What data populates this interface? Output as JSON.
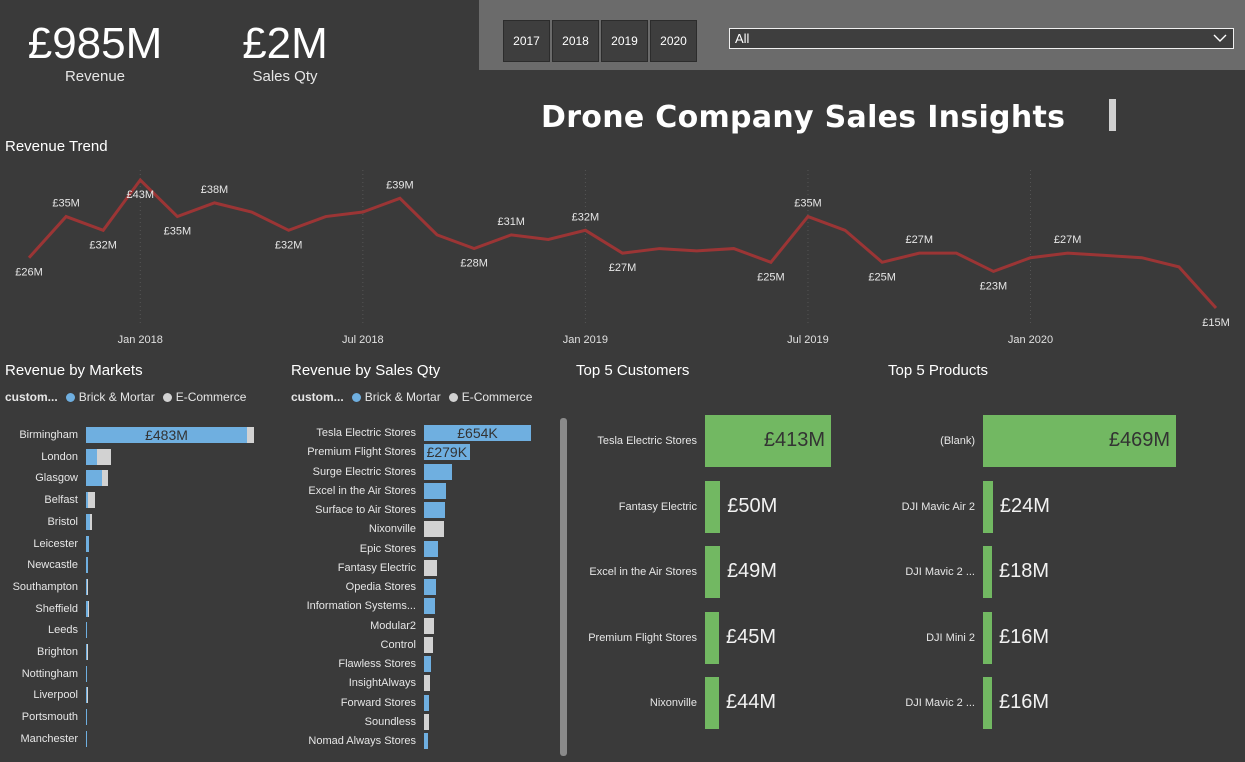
{
  "kpis": {
    "revenue": {
      "value": "£985M",
      "label": "Revenue"
    },
    "sales_qty": {
      "value": "£2M",
      "label": "Sales Qty"
    }
  },
  "year_slicer": {
    "buttons": [
      "2017",
      "2018",
      "2019",
      "2020"
    ]
  },
  "filter_dropdown": {
    "selected": "All",
    "icon": "chevron-down-icon"
  },
  "title": "Drone Company Sales Insights",
  "revenue_trend": {
    "title": "Revenue Trend",
    "x_ticks": [
      "Jan 2018",
      "Jul 2018",
      "Jan 2019",
      "Jul 2019",
      "Jan 2020"
    ],
    "line_color": "#9b3535"
  },
  "chart_data": [
    {
      "type": "line",
      "title": "Revenue Trend",
      "x": [
        "2017-10",
        "2017-11",
        "2017-12",
        "2018-01",
        "2018-02",
        "2018-03",
        "2018-04",
        "2018-05",
        "2018-06",
        "2018-07",
        "2018-08",
        "2018-09",
        "2018-10",
        "2018-11",
        "2018-12",
        "2019-01",
        "2019-02",
        "2019-03",
        "2019-04",
        "2019-05",
        "2019-06",
        "2019-07",
        "2019-08",
        "2019-09",
        "2019-10",
        "2019-11",
        "2019-12",
        "2020-01",
        "2020-02",
        "2020-03",
        "2020-04",
        "2020-05",
        "2020-06"
      ],
      "values": [
        26,
        35,
        32,
        43,
        35,
        38,
        36,
        32,
        35,
        36,
        39,
        31,
        28,
        31,
        30,
        32,
        27,
        28,
        27.5,
        28,
        25,
        35,
        32,
        25,
        27,
        27,
        23,
        26,
        27,
        26.5,
        26,
        24,
        15
      ],
      "data_labels": [
        {
          "i": 0,
          "text": "£26M",
          "pos": "below"
        },
        {
          "i": 1,
          "text": "£35M",
          "pos": "above"
        },
        {
          "i": 2,
          "text": "£32M",
          "pos": "below"
        },
        {
          "i": 3,
          "text": "£43M",
          "pos": "below"
        },
        {
          "i": 4,
          "text": "£35M",
          "pos": "below"
        },
        {
          "i": 5,
          "text": "£38M",
          "pos": "above"
        },
        {
          "i": 7,
          "text": "£32M",
          "pos": "below"
        },
        {
          "i": 10,
          "text": "£39M",
          "pos": "above"
        },
        {
          "i": 12,
          "text": "£28M",
          "pos": "below"
        },
        {
          "i": 13,
          "text": "£31M",
          "pos": "above"
        },
        {
          "i": 15,
          "text": "£32M",
          "pos": "above"
        },
        {
          "i": 16,
          "text": "£27M",
          "pos": "below"
        },
        {
          "i": 20,
          "text": "£25M",
          "pos": "below"
        },
        {
          "i": 21,
          "text": "£35M",
          "pos": "above"
        },
        {
          "i": 23,
          "text": "£25M",
          "pos": "below"
        },
        {
          "i": 24,
          "text": "£27M",
          "pos": "above"
        },
        {
          "i": 26,
          "text": "£23M",
          "pos": "below"
        },
        {
          "i": 28,
          "text": "£27M",
          "pos": "above"
        },
        {
          "i": 32,
          "text": "£15M",
          "pos": "below"
        }
      ],
      "xtick_labels": [
        "Jan 2018",
        "Jul 2018",
        "Jan 2019",
        "Jul 2019",
        "Jan 2020"
      ],
      "grid": false
    },
    {
      "type": "bar",
      "title": "Revenue by Markets",
      "legend": [
        "Brick & Mortar",
        "E-Commerce"
      ],
      "categories": [
        "Birmingham",
        "London",
        "Glasgow",
        "Belfast",
        "Bristol",
        "Leicester",
        "Newcastle",
        "Southampton",
        "Sheffield",
        "Leeds",
        "Brighton",
        "Nottingham",
        "Liverpool",
        "Portsmouth",
        "Manchester"
      ],
      "series": [
        {
          "name": "Brick & Mortar",
          "values": [
            463,
            31,
            47,
            7,
            12,
            8,
            7,
            3,
            6,
            4,
            2,
            2,
            1,
            1,
            0.5
          ]
        },
        {
          "name": "E-Commerce",
          "values": [
            20,
            41,
            16,
            19,
            6,
            0,
            0,
            4,
            2,
            0,
            1,
            0,
            1,
            0,
            0
          ]
        }
      ],
      "data_labels": [
        {
          "i": 0,
          "text": "£483M"
        }
      ]
    },
    {
      "type": "bar",
      "title": "Revenue by Sales Qty",
      "legend": [
        "Brick & Mortar",
        "E-Commerce"
      ],
      "categories": [
        "Tesla Electric Stores",
        "Premium Flight Stores",
        "Surge Electric Stores",
        "Excel in the Air Stores",
        "Surface to Air Stores",
        "Nixonville",
        "Epic Stores",
        "Fantasy Electric",
        "Opedia Stores",
        "Information Systems...",
        "Modular2",
        "Control",
        "Flawless Stores",
        "InsightAlways",
        "Forward Stores",
        "Soundless",
        "Nomad Always Stores"
      ],
      "series": [
        {
          "name": "Brick & Mortar",
          "values": [
            654,
            279,
            170,
            135,
            130,
            0,
            85,
            0,
            75,
            70,
            0,
            0,
            40,
            0,
            30,
            0,
            25
          ]
        },
        {
          "name": "E-Commerce",
          "values": [
            0,
            0,
            0,
            0,
            0,
            125,
            0,
            80,
            0,
            0,
            60,
            55,
            0,
            35,
            0,
            28,
            0
          ]
        }
      ],
      "data_labels": [
        {
          "i": 0,
          "text": "£654K"
        },
        {
          "i": 1,
          "text": "£279K"
        }
      ]
    },
    {
      "type": "bar",
      "title": "Top 5 Customers",
      "categories": [
        "Tesla Electric Stores",
        "Fantasy Electric",
        "Excel in the Air Stores",
        "Premium Flight Stores",
        "Nixonville"
      ],
      "values": [
        413,
        50,
        49,
        45,
        44
      ],
      "data_labels": [
        "£413M",
        "£50M",
        "£49M",
        "£45M",
        "£44M"
      ]
    },
    {
      "type": "bar",
      "title": "Top 5 Products",
      "categories": [
        "(Blank)",
        "DJI Mavic Air 2",
        "DJI Mavic 2 ...",
        "DJI Mini 2",
        "DJI Mavic 2 ..."
      ],
      "values": [
        469,
        24,
        18,
        16,
        16
      ],
      "data_labels": [
        "£469M",
        "£24M",
        "£18M",
        "£16M",
        "£16M"
      ]
    }
  ],
  "markets": {
    "title": "Revenue by Markets",
    "legend_title": "custom...",
    "legend_items": [
      {
        "label": "Brick & Mortar",
        "color": "#6fafe0"
      },
      {
        "label": "E-Commerce",
        "color": "#d2d2d2"
      }
    ]
  },
  "salesqty": {
    "title": "Revenue by Sales Qty",
    "legend_title": "custom...",
    "legend_items": [
      {
        "label": "Brick & Mortar",
        "color": "#6fafe0"
      },
      {
        "label": "E-Commerce",
        "color": "#d2d2d2"
      }
    ]
  },
  "top_customers": {
    "title": "Top 5 Customers"
  },
  "top_products": {
    "title": "Top 5 Products"
  },
  "colors": {
    "background": "#3a3a3a",
    "brick_mortar": "#6fafe0",
    "ecommerce": "#d2d2d2",
    "top5_bar": "#72b862",
    "trend_line": "#9b3535"
  }
}
